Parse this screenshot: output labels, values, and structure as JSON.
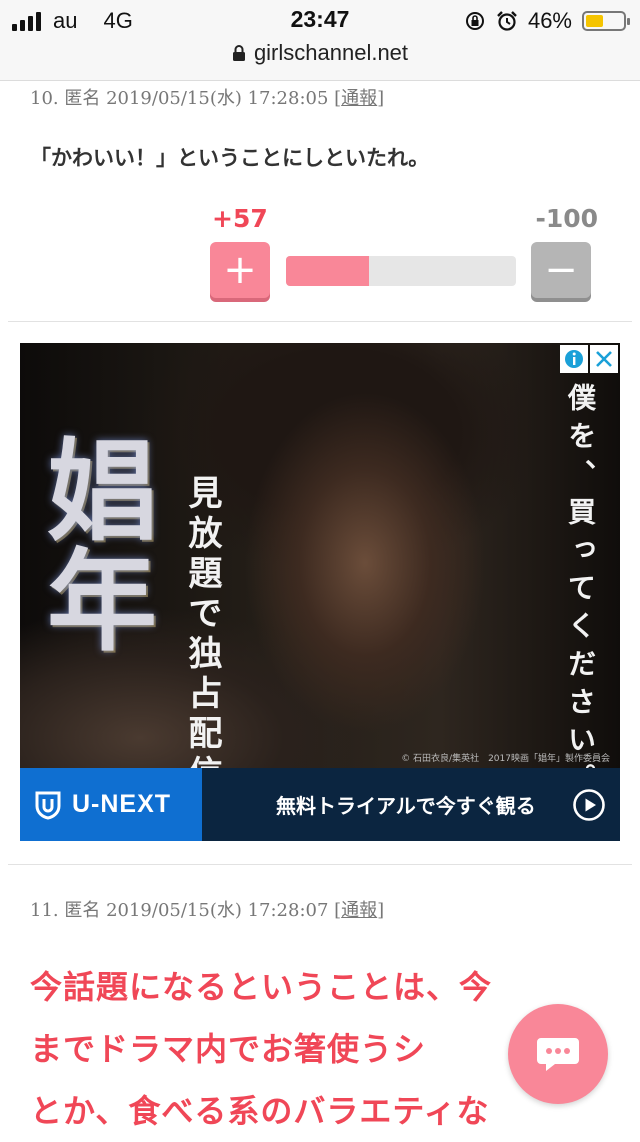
{
  "status_bar": {
    "carrier": "au",
    "network": "4G",
    "time": "23:47",
    "battery_percent": "46%",
    "battery_level": 0.46,
    "battery_color": "#f5c400"
  },
  "url_bar": {
    "domain": "girlschannel.net"
  },
  "comment_10": {
    "header": "10. 匿名 2019/05/15(水) 17:28:05 [",
    "report": "通報",
    "header_end": "]",
    "text": "「かわいい！」ということにしといたれ。",
    "plus_count": "+57",
    "minus_count": "-100",
    "plus_label": "+",
    "minus_label": "−",
    "vote_ratio": 0.363
  },
  "ad": {
    "title": "娼年",
    "subtitle": "見放題で独占配信",
    "tagline": "僕を、買ってください。",
    "credit": "© 石田衣良/集英社　2017映画「娼年」製作委員会",
    "brand": "U-NEXT",
    "cta": "無料トライアルで今すぐ観る",
    "icons": [
      "info-icon",
      "close-icon",
      "play-icon"
    ]
  },
  "comment_11": {
    "header": "11. 匿名 2019/05/15(水) 17:28:07 [",
    "report": "通報",
    "header_end": "]",
    "lines": [
      "今話題になるということは、今",
      "までドラマ内でお箸使うシ",
      "とか、食べる系のバラエティな"
    ]
  },
  "colors": {
    "accent_pink": "#f98798",
    "plus_red": "#f04757",
    "unext_blue": "#0f6fd1"
  }
}
